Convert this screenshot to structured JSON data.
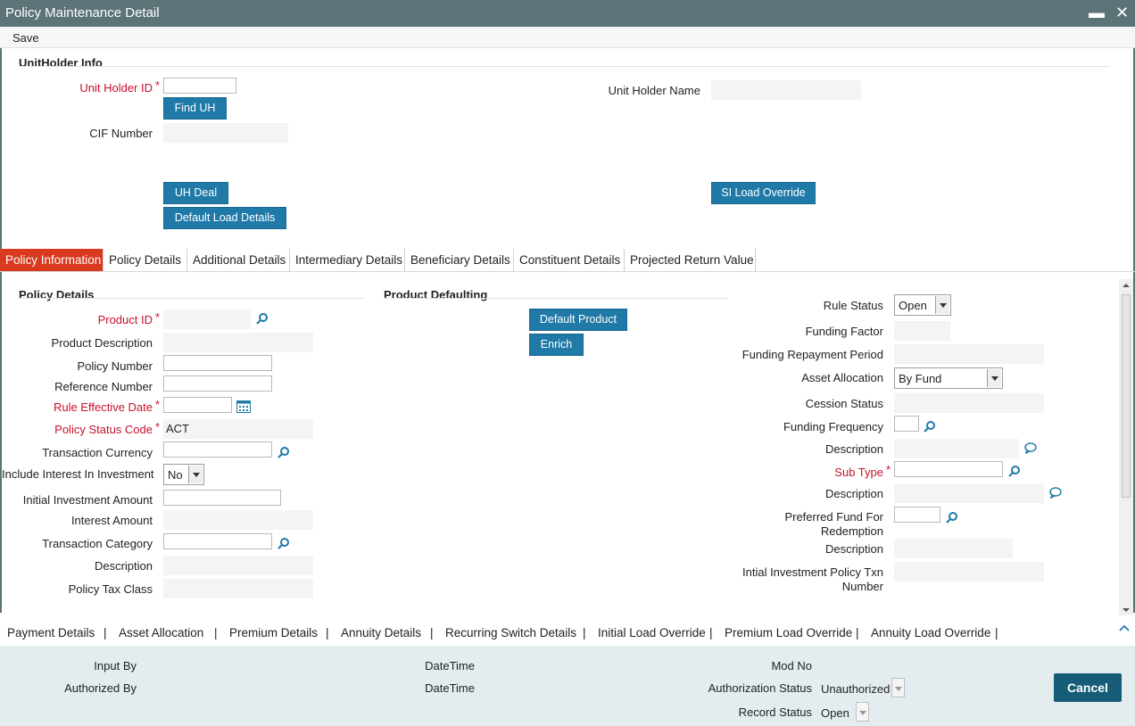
{
  "window": {
    "title": "Policy Maintenance Detail",
    "minimize": "▬",
    "close": "✕"
  },
  "menu": {
    "save": "Save"
  },
  "unitholder": {
    "section": "UnitHolder Info",
    "unit_holder_id_label": "Unit Holder ID",
    "find_uh": "Find UH",
    "cif_label": "CIF Number",
    "unit_holder_name_label": "Unit Holder Name",
    "uh_deal": "UH Deal",
    "default_load_details": "Default Load Details",
    "si_load_override": "SI Load Override"
  },
  "tabs": [
    "Policy Information",
    "Policy Details",
    "Additional Details",
    "Intermediary Details",
    "Beneficiary Details",
    "Constituent Details",
    "Projected Return Value"
  ],
  "policy_details": {
    "section": "Policy Details",
    "product_id": "Product ID",
    "product_description": "Product Description",
    "policy_number": "Policy Number",
    "reference_number": "Reference Number",
    "rule_effective_date": "Rule Effective Date",
    "policy_status_code": "Policy Status Code",
    "policy_status_value": "ACT",
    "transaction_currency": "Transaction Currency",
    "include_interest": "Include Interest In Investment",
    "include_interest_value": "No",
    "initial_investment_amount": "Initial Investment Amount",
    "interest_amount": "Interest Amount",
    "transaction_category": "Transaction Category",
    "description": "Description",
    "policy_tax_class": "Policy Tax Class"
  },
  "product_defaulting": {
    "section": "Product Defaulting",
    "default_product": "Default Product",
    "enrich": "Enrich"
  },
  "right_panel": {
    "rule_status": "Rule Status",
    "rule_status_value": "Open",
    "funding_factor": "Funding Factor",
    "funding_repayment_period": "Funding Repayment Period",
    "asset_allocation": "Asset Allocation",
    "asset_allocation_value": "By Fund",
    "cession_status": "Cession Status",
    "funding_frequency": "Funding Frequency",
    "description": "Description",
    "sub_type": "Sub Type",
    "description2": "Description",
    "preferred_fund_line1": "Preferred Fund For",
    "preferred_fund_line2": "Redemption",
    "description3": "Description",
    "initial_inv_line1": "Intial Investment Policy Txn",
    "initial_inv_line2": "Number"
  },
  "bottom_links": [
    "Payment Details",
    "Asset Allocation",
    "Premium Details",
    "Annuity Details",
    "Recurring Switch Details",
    "Initial Load Override",
    "Premium Load Override",
    "Annuity Load Override"
  ],
  "separator": "|",
  "footer": {
    "input_by": "Input By",
    "authorized_by": "Authorized By",
    "datetime1": "DateTime",
    "datetime2": "DateTime",
    "mod_no": "Mod No",
    "authorization_status": "Authorization Status",
    "authorization_status_value": "Unauthorized",
    "record_status": "Record Status",
    "record_status_value": "Open",
    "cancel": "Cancel"
  },
  "colors": {
    "titlebar": "#5c7378",
    "button": "#1f7aa8",
    "active_tab": "#d9391e",
    "required": "#c8102e",
    "footer_bg": "#e3edf0",
    "cancel": "#165c79"
  },
  "star": "*"
}
